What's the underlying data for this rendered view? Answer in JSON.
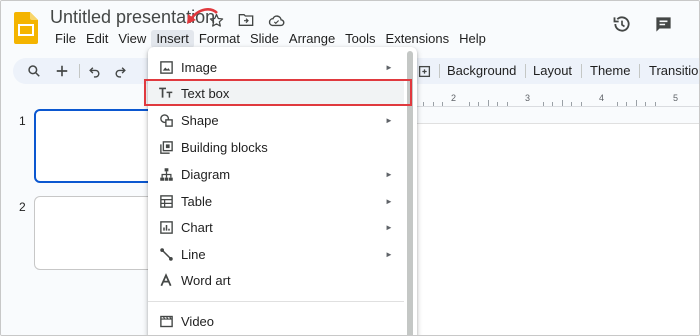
{
  "app": {
    "title": "Untitled presentation",
    "brand_color": "#f4b400"
  },
  "menu": [
    "File",
    "Edit",
    "View",
    "Insert",
    "Format",
    "Slide",
    "Arrange",
    "Tools",
    "Extensions",
    "Help"
  ],
  "active_menu": "Insert",
  "title_icons": [
    "star-icon",
    "move-to-folder-icon",
    "cloud-saved-icon"
  ],
  "header_right": [
    "version-history-icon",
    "comments-icon"
  ],
  "toolbar": {
    "left_icons": [
      "search-icon",
      "add-icon",
      "undo-icon",
      "redo-icon"
    ],
    "buttons": [
      "Background",
      "Layout",
      "Theme",
      "Transition"
    ]
  },
  "slides": [
    {
      "number": "1",
      "selected": true
    },
    {
      "number": "2",
      "selected": false
    }
  ],
  "ruler": {
    "labels": [
      "2",
      "3",
      "4",
      "5"
    ]
  },
  "insert_menu": {
    "items": [
      {
        "label": "Image",
        "icon": "image-icon",
        "submenu": true
      },
      {
        "label": "Text box",
        "icon": "text-box-icon",
        "submenu": false,
        "highlighted": true
      },
      {
        "label": "Shape",
        "icon": "shape-icon",
        "submenu": true
      },
      {
        "label": "Building blocks",
        "icon": "building-blocks-icon",
        "submenu": false
      },
      {
        "label": "Diagram",
        "icon": "diagram-icon",
        "submenu": true
      },
      {
        "label": "Table",
        "icon": "table-icon",
        "submenu": true
      },
      {
        "label": "Chart",
        "icon": "chart-icon",
        "submenu": true
      },
      {
        "label": "Line",
        "icon": "line-icon",
        "submenu": true
      },
      {
        "label": "Word art",
        "icon": "word-art-icon",
        "submenu": false
      },
      {
        "label": "Video",
        "icon": "video-icon",
        "submenu": false
      }
    ]
  },
  "annotation": {
    "color": "#e0393e"
  }
}
